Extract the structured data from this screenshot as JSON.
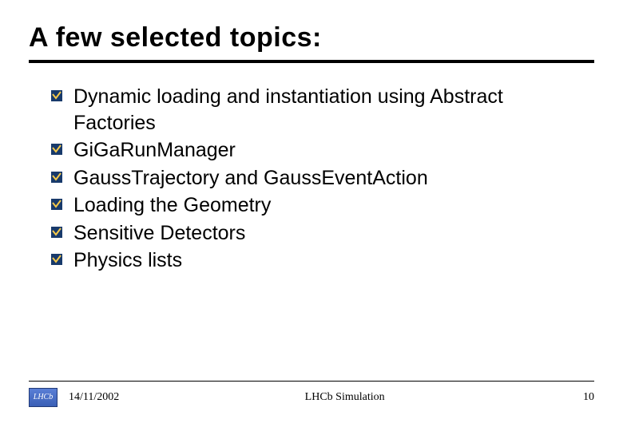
{
  "title": "A few selected topics:",
  "bullets": [
    "Dynamic loading and instantiation using Abstract Factories",
    "GiGaRunManager",
    "GaussTrajectory and GaussEventAction",
    "Loading the Geometry",
    "Sensitive Detectors",
    "Physics lists"
  ],
  "footer": {
    "logo_text": "LHCb",
    "date": "14/11/2002",
    "center": "LHCb Simulation",
    "page": "10"
  }
}
